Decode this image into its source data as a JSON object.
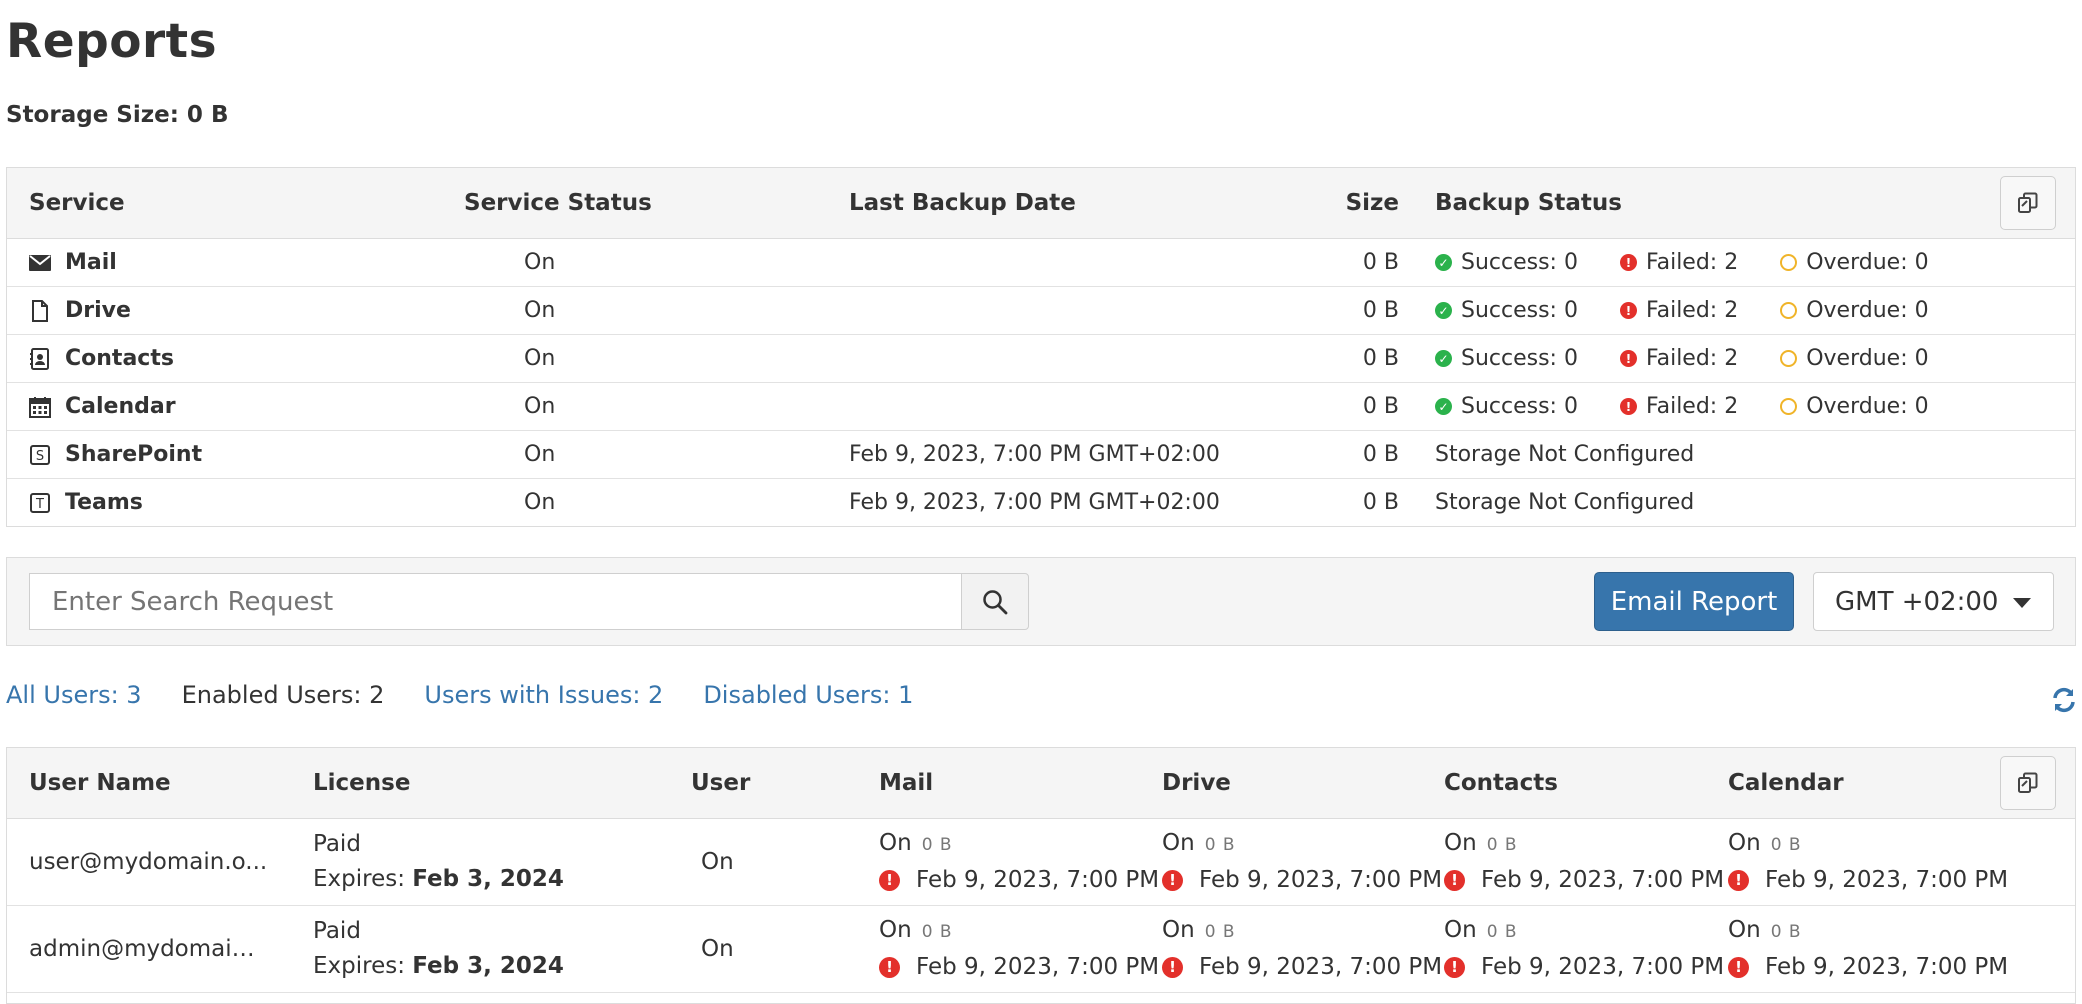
{
  "page": {
    "title": "Reports",
    "storage_size": "Storage Size: 0 B"
  },
  "services_table": {
    "headers": {
      "service": "Service",
      "service_status": "Service Status",
      "last_backup_date": "Last Backup Date",
      "size": "Size",
      "backup_status": "Backup Status"
    },
    "rows": [
      {
        "name": "Mail",
        "icon": "envelope-icon",
        "status": "On",
        "date": "",
        "size": "0 B",
        "success": "Success: 0",
        "failed": "Failed: 2",
        "overdue": "Overdue: 0",
        "note": ""
      },
      {
        "name": "Drive",
        "icon": "file-icon",
        "status": "On",
        "date": "",
        "size": "0 B",
        "success": "Success: 0",
        "failed": "Failed: 2",
        "overdue": "Overdue: 0",
        "note": ""
      },
      {
        "name": "Contacts",
        "icon": "contact-card-icon",
        "status": "On",
        "date": "",
        "size": "0 B",
        "success": "Success: 0",
        "failed": "Failed: 2",
        "overdue": "Overdue: 0",
        "note": ""
      },
      {
        "name": "Calendar",
        "icon": "calendar-icon",
        "status": "On",
        "date": "",
        "size": "0 B",
        "success": "Success: 0",
        "failed": "Failed: 2",
        "overdue": "Overdue: 0",
        "note": ""
      },
      {
        "name": "SharePoint",
        "icon": "sharepoint-s-icon",
        "status": "On",
        "date": "Feb 9, 2023, 7:00 PM GMT+02:00",
        "size": "0 B",
        "note": "Storage Not Configured"
      },
      {
        "name": "Teams",
        "icon": "teams-t-icon",
        "status": "On",
        "date": "Feb 9, 2023, 7:00 PM GMT+02:00",
        "size": "0 B",
        "note": "Storage Not Configured"
      }
    ]
  },
  "search": {
    "placeholder": "Enter Search Request",
    "email_report_label": "Email Report",
    "timezone": "GMT +02:00"
  },
  "filters": {
    "all_users": "All Users: 3",
    "enabled_users": "Enabled Users: 2",
    "users_with_issues": "Users with Issues: 2",
    "disabled_users": "Disabled Users: 1"
  },
  "users_table": {
    "headers": {
      "user_name": "User Name",
      "license": "License",
      "user": "User",
      "mail": "Mail",
      "drive": "Drive",
      "contacts": "Contacts",
      "calendar": "Calendar"
    },
    "rows": [
      {
        "user_name": "user@mydomain.o...",
        "license_type": "Paid",
        "expires_label": "Expires: ",
        "expires_date": "Feb 3, 2024",
        "user_status": "On",
        "mail": {
          "status": "On",
          "size": "0 B",
          "date": "Feb 9, 2023, 7:00 PM"
        },
        "drive": {
          "status": "On",
          "size": "0 B",
          "date": "Feb 9, 2023, 7:00 PM"
        },
        "contacts": {
          "status": "On",
          "size": "0 B",
          "date": "Feb 9, 2023, 7:00 PM"
        },
        "calendar": {
          "status": "On",
          "size": "0 B",
          "date": "Feb 9, 2023, 7:00 PM"
        }
      },
      {
        "user_name": "admin@mydomain....",
        "license_type": "Paid",
        "expires_label": "Expires: ",
        "expires_date": "Feb 3, 2024",
        "user_status": "On",
        "mail": {
          "status": "On",
          "size": "0 B",
          "date": "Feb 9, 2023, 7:00 PM"
        },
        "drive": {
          "status": "On",
          "size": "0 B",
          "date": "Feb 9, 2023, 7:00 PM"
        },
        "contacts": {
          "status": "On",
          "size": "0 B",
          "date": "Feb 9, 2023, 7:00 PM"
        },
        "calendar": {
          "status": "On",
          "size": "0 B",
          "date": "Feb 9, 2023, 7:00 PM"
        }
      }
    ]
  },
  "colors": {
    "accent": "#3775ac",
    "success": "#2bb24c",
    "failed": "#e3302b",
    "overdue": "#f0b429"
  }
}
